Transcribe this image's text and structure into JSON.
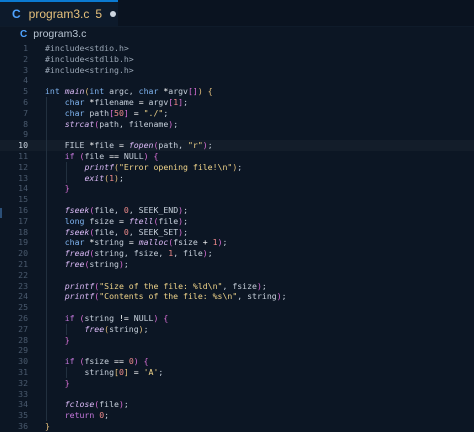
{
  "tab": {
    "lang_icon": "C",
    "filename": "program3.c",
    "badge": "5",
    "modified_indicator": "unsaved-dot"
  },
  "breadcrumb": {
    "lang_icon": "C",
    "file": "program3.c"
  },
  "editor": {
    "current_line": 10,
    "lines": [
      {
        "n": "1",
        "indent": 0,
        "tokens": [
          [
            "pp",
            "#include<stdio.h>"
          ]
        ]
      },
      {
        "n": "2",
        "indent": 0,
        "tokens": [
          [
            "pp",
            "#include<stdlib.h>"
          ]
        ]
      },
      {
        "n": "3",
        "indent": 0,
        "tokens": [
          [
            "pp",
            "#include<string.h>"
          ]
        ]
      },
      {
        "n": "4",
        "indent": 0,
        "tokens": []
      },
      {
        "n": "5",
        "indent": 0,
        "tokens": [
          [
            "type",
            "int "
          ],
          [
            "fn",
            "main"
          ],
          [
            "br1",
            "("
          ],
          [
            "type",
            "int "
          ],
          [
            "pn",
            "argc, "
          ],
          [
            "type",
            "char "
          ],
          [
            "op",
            "*"
          ],
          [
            "pn",
            "argv"
          ],
          [
            "br2",
            "[]"
          ],
          [
            "br1",
            ")"
          ],
          [
            "pn",
            " "
          ],
          [
            "br1",
            "{"
          ]
        ]
      },
      {
        "n": "6",
        "indent": 1,
        "tokens": [
          [
            "type",
            "char "
          ],
          [
            "op",
            "*"
          ],
          [
            "pn",
            "filename "
          ],
          [
            "op",
            "= "
          ],
          [
            "pn",
            "argv"
          ],
          [
            "br2",
            "["
          ],
          [
            "num",
            "1"
          ],
          [
            "br2",
            "]"
          ],
          [
            "pn",
            ";"
          ]
        ]
      },
      {
        "n": "7",
        "indent": 1,
        "tokens": [
          [
            "type",
            "char "
          ],
          [
            "pn",
            "path"
          ],
          [
            "br2",
            "["
          ],
          [
            "num",
            "50"
          ],
          [
            "br2",
            "]"
          ],
          [
            "pn",
            " "
          ],
          [
            "op",
            "= "
          ],
          [
            "str",
            "\"./\""
          ],
          [
            "pn",
            ";"
          ]
        ]
      },
      {
        "n": "8",
        "indent": 1,
        "tokens": [
          [
            "fn",
            "strcat"
          ],
          [
            "br2",
            "("
          ],
          [
            "pn",
            "path, filename"
          ],
          [
            "br2",
            ")"
          ],
          [
            "pn",
            ";"
          ]
        ]
      },
      {
        "n": "9",
        "indent": 1,
        "tokens": []
      },
      {
        "n": "10",
        "indent": 1,
        "tokens": [
          [
            "pn",
            "FILE "
          ],
          [
            "op",
            "*"
          ],
          [
            "pn",
            "file "
          ],
          [
            "op",
            "= "
          ],
          [
            "fn",
            "fopen"
          ],
          [
            "br2",
            "("
          ],
          [
            "pn",
            "path, "
          ],
          [
            "str",
            "\"r\""
          ],
          [
            "br2",
            ")"
          ],
          [
            "pn",
            ";"
          ]
        ]
      },
      {
        "n": "11",
        "indent": 1,
        "tokens": [
          [
            "kw",
            "if "
          ],
          [
            "br2",
            "("
          ],
          [
            "pn",
            "file "
          ],
          [
            "op",
            "== "
          ],
          [
            "pn",
            "NULL"
          ],
          [
            "br2",
            ")"
          ],
          [
            "pn",
            " "
          ],
          [
            "br2",
            "{"
          ]
        ]
      },
      {
        "n": "12",
        "indent": 2,
        "tokens": [
          [
            "fn",
            "printf"
          ],
          [
            "br1",
            "("
          ],
          [
            "str",
            "\"Error opening file!\\n\""
          ],
          [
            "br1",
            ")"
          ],
          [
            "pn",
            ";"
          ]
        ]
      },
      {
        "n": "13",
        "indent": 2,
        "tokens": [
          [
            "fn",
            "exit"
          ],
          [
            "br1",
            "("
          ],
          [
            "num",
            "1"
          ],
          [
            "br1",
            ")"
          ],
          [
            "pn",
            ";"
          ]
        ]
      },
      {
        "n": "14",
        "indent": 1,
        "tokens": [
          [
            "br2",
            "}"
          ]
        ]
      },
      {
        "n": "15",
        "indent": 1,
        "tokens": []
      },
      {
        "n": "16",
        "indent": 1,
        "tokens": [
          [
            "fn",
            "fseek"
          ],
          [
            "br2",
            "("
          ],
          [
            "pn",
            "file, "
          ],
          [
            "num",
            "0"
          ],
          [
            "pn",
            ", SEEK_END"
          ],
          [
            "br2",
            ")"
          ],
          [
            "pn",
            ";"
          ]
        ]
      },
      {
        "n": "17",
        "indent": 1,
        "tokens": [
          [
            "type",
            "long "
          ],
          [
            "pn",
            "fsize "
          ],
          [
            "op",
            "= "
          ],
          [
            "fn",
            "ftell"
          ],
          [
            "br2",
            "("
          ],
          [
            "pn",
            "file"
          ],
          [
            "br2",
            ")"
          ],
          [
            "pn",
            ";"
          ]
        ]
      },
      {
        "n": "18",
        "indent": 1,
        "tokens": [
          [
            "fn",
            "fseek"
          ],
          [
            "br2",
            "("
          ],
          [
            "pn",
            "file, "
          ],
          [
            "num",
            "0"
          ],
          [
            "pn",
            ", SEEK_SET"
          ],
          [
            "br2",
            ")"
          ],
          [
            "pn",
            ";"
          ]
        ]
      },
      {
        "n": "19",
        "indent": 1,
        "tokens": [
          [
            "type",
            "char "
          ],
          [
            "op",
            "*"
          ],
          [
            "pn",
            "string "
          ],
          [
            "op",
            "= "
          ],
          [
            "fn",
            "malloc"
          ],
          [
            "br2",
            "("
          ],
          [
            "pn",
            "fsize "
          ],
          [
            "op",
            "+ "
          ],
          [
            "num",
            "1"
          ],
          [
            "br2",
            ")"
          ],
          [
            "pn",
            ";"
          ]
        ]
      },
      {
        "n": "20",
        "indent": 1,
        "tokens": [
          [
            "fn",
            "fread"
          ],
          [
            "br2",
            "("
          ],
          [
            "pn",
            "string, fsize, "
          ],
          [
            "num",
            "1"
          ],
          [
            "pn",
            ", file"
          ],
          [
            "br2",
            ")"
          ],
          [
            "pn",
            ";"
          ]
        ]
      },
      {
        "n": "21",
        "indent": 1,
        "tokens": [
          [
            "fn",
            "free"
          ],
          [
            "br2",
            "("
          ],
          [
            "pn",
            "string"
          ],
          [
            "br2",
            ")"
          ],
          [
            "pn",
            ";"
          ]
        ]
      },
      {
        "n": "22",
        "indent": 1,
        "tokens": []
      },
      {
        "n": "23",
        "indent": 1,
        "tokens": [
          [
            "fn",
            "printf"
          ],
          [
            "br2",
            "("
          ],
          [
            "str",
            "\"Size of the file: %ld\\n\""
          ],
          [
            "pn",
            ", fsize"
          ],
          [
            "br2",
            ")"
          ],
          [
            "pn",
            ";"
          ]
        ]
      },
      {
        "n": "24",
        "indent": 1,
        "tokens": [
          [
            "fn",
            "printf"
          ],
          [
            "br2",
            "("
          ],
          [
            "str",
            "\"Contents of the file: %s\\n\""
          ],
          [
            "pn",
            ", string"
          ],
          [
            "br2",
            ")"
          ],
          [
            "pn",
            ";"
          ]
        ]
      },
      {
        "n": "25",
        "indent": 1,
        "tokens": []
      },
      {
        "n": "26",
        "indent": 1,
        "tokens": [
          [
            "kw",
            "if "
          ],
          [
            "br2",
            "("
          ],
          [
            "pn",
            "string "
          ],
          [
            "op",
            "!= "
          ],
          [
            "pn",
            "NULL"
          ],
          [
            "br2",
            ")"
          ],
          [
            "pn",
            " "
          ],
          [
            "br2",
            "{"
          ]
        ]
      },
      {
        "n": "27",
        "indent": 2,
        "tokens": [
          [
            "fn",
            "free"
          ],
          [
            "br1",
            "("
          ],
          [
            "pn",
            "string"
          ],
          [
            "br1",
            ")"
          ],
          [
            "pn",
            ";"
          ]
        ]
      },
      {
        "n": "28",
        "indent": 1,
        "tokens": [
          [
            "br2",
            "}"
          ]
        ]
      },
      {
        "n": "29",
        "indent": 1,
        "tokens": []
      },
      {
        "n": "30",
        "indent": 1,
        "tokens": [
          [
            "kw",
            "if "
          ],
          [
            "br2",
            "("
          ],
          [
            "pn",
            "fsize "
          ],
          [
            "op",
            "== "
          ],
          [
            "num",
            "0"
          ],
          [
            "br2",
            ")"
          ],
          [
            "pn",
            " "
          ],
          [
            "br2",
            "{"
          ]
        ]
      },
      {
        "n": "31",
        "indent": 2,
        "tokens": [
          [
            "pn",
            "string"
          ],
          [
            "br1",
            "["
          ],
          [
            "num",
            "0"
          ],
          [
            "br1",
            "]"
          ],
          [
            "pn",
            " "
          ],
          [
            "op",
            "= "
          ],
          [
            "str",
            "'A'"
          ],
          [
            "pn",
            ";"
          ]
        ]
      },
      {
        "n": "32",
        "indent": 1,
        "tokens": [
          [
            "br2",
            "}"
          ]
        ]
      },
      {
        "n": "33",
        "indent": 1,
        "tokens": []
      },
      {
        "n": "34",
        "indent": 1,
        "tokens": [
          [
            "fn",
            "fclose"
          ],
          [
            "br2",
            "("
          ],
          [
            "pn",
            "file"
          ],
          [
            "br2",
            ")"
          ],
          [
            "pn",
            ";"
          ]
        ]
      },
      {
        "n": "35",
        "indent": 1,
        "tokens": [
          [
            "kw",
            "return "
          ],
          [
            "num",
            "0"
          ],
          [
            "pn",
            ";"
          ]
        ]
      },
      {
        "n": "36",
        "indent": 0,
        "tokens": [
          [
            "br1",
            "}"
          ]
        ]
      }
    ]
  }
}
